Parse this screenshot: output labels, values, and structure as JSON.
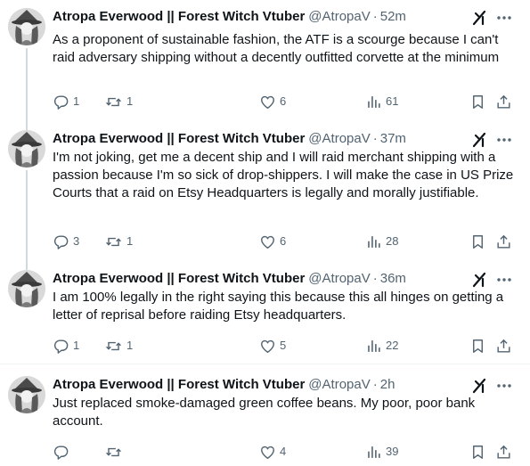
{
  "tweets": [
    {
      "author_name": "Atropa Everwood || Forest Witch Vtuber",
      "handle": "@AtropaV",
      "separator": "·",
      "time": "52m",
      "text": "As a proponent of sustainable fashion, the ATF is a scourge because I can't raid adversary shipping without a decently outfitted corvette at the minimum",
      "replies": "1",
      "reposts": "1",
      "likes": "6",
      "views": "61"
    },
    {
      "author_name": "Atropa Everwood || Forest Witch Vtuber",
      "handle": "@AtropaV",
      "separator": "·",
      "time": "37m",
      "text": "I'm not joking, get me a decent ship and I will raid merchant shipping with a passion because I'm so sick of drop-shippers. I will make the case in US Prize Courts that a raid on Etsy Headquarters is legally and morally justifiable.",
      "replies": "3",
      "reposts": "1",
      "likes": "6",
      "views": "28"
    },
    {
      "author_name": "Atropa Everwood || Forest Witch Vtuber",
      "handle": "@AtropaV",
      "separator": "·",
      "time": "36m",
      "text": "I am 100% legally in the right saying this because this all hinges on getting a letter of reprisal before raiding Etsy headquarters.",
      "replies": "1",
      "reposts": "1",
      "likes": "5",
      "views": "22"
    },
    {
      "author_name": "Atropa Everwood || Forest Witch Vtuber",
      "handle": "@AtropaV",
      "separator": "·",
      "time": "2h",
      "text": "Just replaced smoke-damaged green coffee beans. My poor, poor bank account.",
      "replies": "",
      "reposts": "",
      "likes": "4",
      "views": "39"
    }
  ],
  "icons": {
    "reply": "reply-icon",
    "repost": "repost-icon",
    "like": "heart-icon",
    "views": "views-icon",
    "bookmark": "bookmark-icon",
    "share": "share-icon",
    "grok": "grok-icon",
    "more": "more-icon"
  },
  "colors": {
    "text": "#0f1419",
    "muted": "#536471",
    "thread_line": "#cfd9de",
    "divider": "#eff3f4"
  }
}
